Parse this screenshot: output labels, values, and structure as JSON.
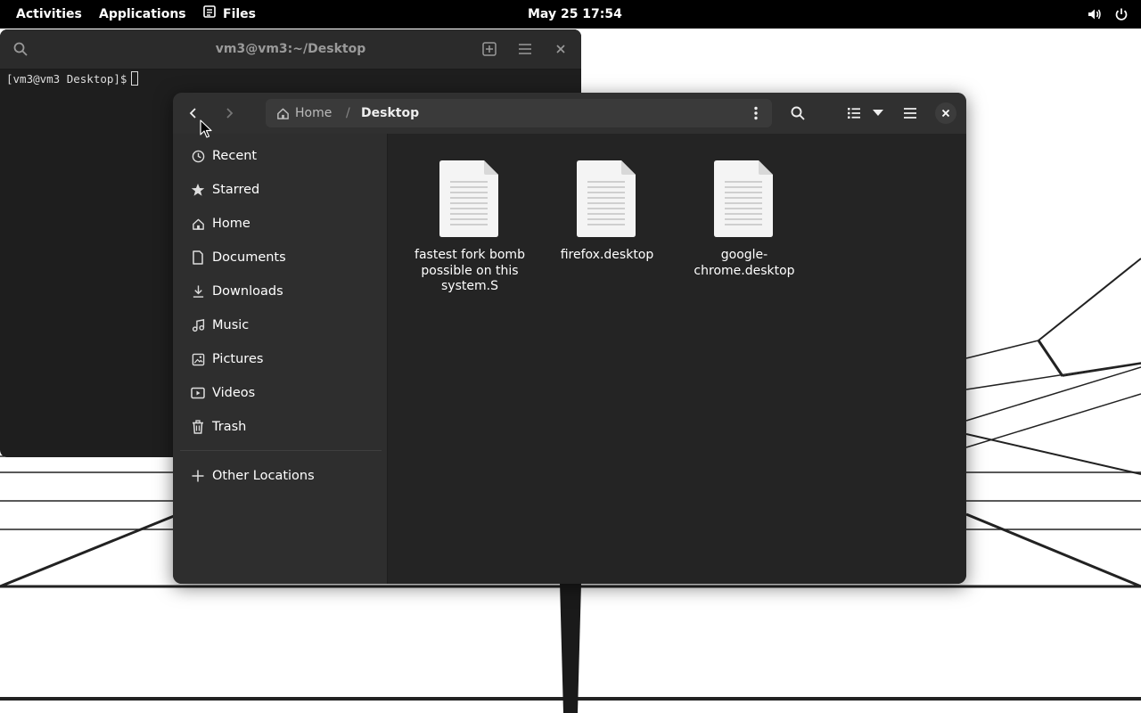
{
  "topbar": {
    "activities": "Activities",
    "applications": "Applications",
    "files": "Files",
    "clock": "May 25  17:54"
  },
  "terminal": {
    "title": "vm3@vm3:~/Desktop",
    "prompt": "[vm3@vm3 Desktop]$"
  },
  "nautilus": {
    "path": {
      "home": "Home",
      "separator": "/",
      "current": "Desktop"
    },
    "sidebar": {
      "items": [
        {
          "label": "Recent",
          "icon": "clock-icon"
        },
        {
          "label": "Starred",
          "icon": "star-icon"
        },
        {
          "label": "Home",
          "icon": "home-icon"
        },
        {
          "label": "Documents",
          "icon": "document-icon"
        },
        {
          "label": "Downloads",
          "icon": "download-icon"
        },
        {
          "label": "Music",
          "icon": "music-icon"
        },
        {
          "label": "Pictures",
          "icon": "picture-icon"
        },
        {
          "label": "Videos",
          "icon": "video-icon"
        },
        {
          "label": "Trash",
          "icon": "trash-icon"
        }
      ],
      "other_locations": "Other Locations"
    },
    "files": [
      {
        "name": "fastest fork bomb possible on this system.S"
      },
      {
        "name": "firefox.desktop"
      },
      {
        "name": "google-chrome.desktop"
      }
    ]
  }
}
